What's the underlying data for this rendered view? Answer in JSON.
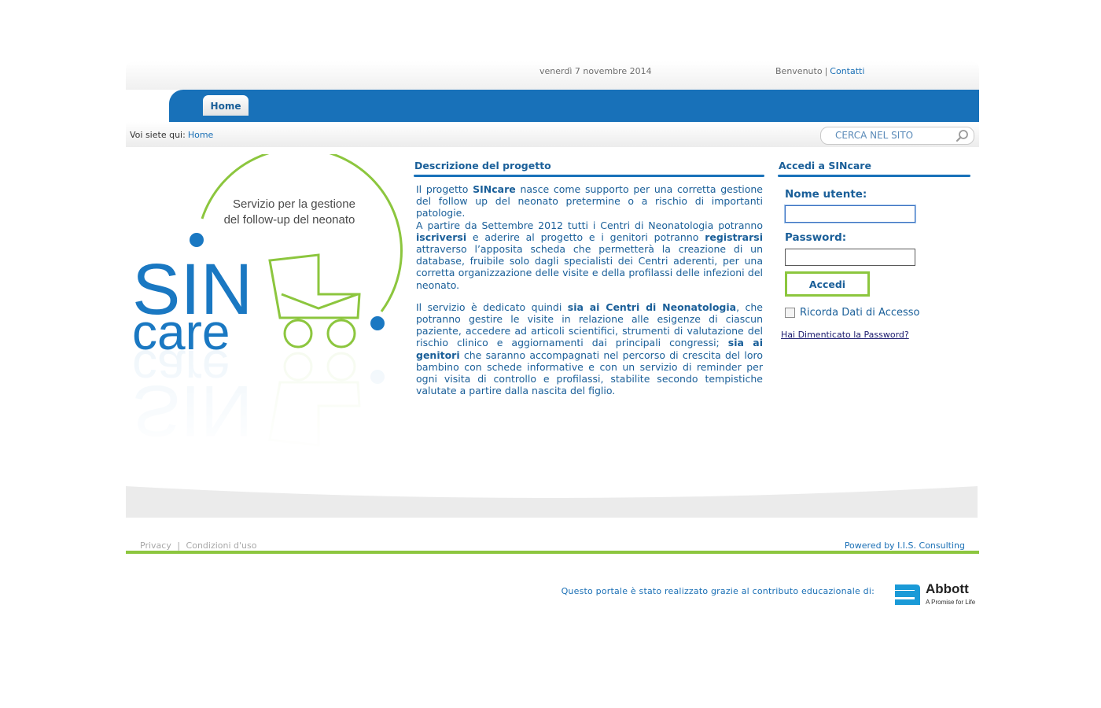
{
  "topbar": {
    "date": "venerdì 7 novembre 2014",
    "welcome": "Benvenuto",
    "separator": "|",
    "contact": "Contatti"
  },
  "nav": {
    "tabs": [
      {
        "label": "Home"
      }
    ]
  },
  "breadcrumb": {
    "prefix": "Voi siete qui:",
    "current": "Home"
  },
  "search": {
    "placeholder": "CERCA NEL SITO"
  },
  "logo": {
    "tagline_line1": "Servizio per la gestione",
    "tagline_line2": "del follow-up del neonato",
    "word1": "SIN",
    "word2": "care",
    "colors": {
      "blue": "#1a78c2",
      "green": "#8cc63e"
    }
  },
  "description": {
    "title": "Descrizione del progetto",
    "p1": [
      {
        "t": "Il progetto "
      },
      {
        "t": "SINcare",
        "b": true
      },
      {
        "t": " nasce come supporto per una corretta gestione del follow up del neonato pretermine o a rischio di importanti patologie."
      },
      {
        "br": true
      },
      {
        "t": "A partire da Settembre 2012 tutti i Centri di Neonatologia potranno "
      },
      {
        "t": "iscriversi",
        "b": true
      },
      {
        "t": " e aderire al progetto e i genitori potranno "
      },
      {
        "t": "registrarsi",
        "b": true
      },
      {
        "t": " attraverso l’apposita scheda che permetterà la creazione di un database, fruibile solo dagli specialisti dei Centri aderenti, per una corretta organizzazione delle visite e della profilassi delle infezioni del neonato."
      }
    ],
    "p2": [
      {
        "t": "Il servizio è dedicato quindi "
      },
      {
        "t": "sia ai Centri di Neonatologia",
        "b": true
      },
      {
        "t": ", che potranno gestire le visite in relazione alle esigenze di ciascun paziente, accedere ad articoli scientifici, strumenti di valutazione del rischio clinico e aggiornamenti dai principali congressi; "
      },
      {
        "t": "sia ai genitori",
        "b": true
      },
      {
        "t": " che saranno accompagnati nel percorso di crescita del loro bambino con schede informative e con un servizio di reminder per ogni visita di controllo e profilassi, stabilite secondo tempistiche valutate a partire dalla nascita del figlio."
      }
    ]
  },
  "login": {
    "title": "Accedi a SINcare",
    "username_label": "Nome utente:",
    "username_value": "",
    "password_label": "Password:",
    "password_value": "",
    "submit": "Accedi",
    "remember": "Ricorda Dati di Accesso",
    "remember_checked": false,
    "forgot": "Hai Dimenticato la Password?"
  },
  "footer": {
    "privacy": "Privacy",
    "separator": "|",
    "terms": "Condizioni d'uso",
    "powered": "Powered by I.I.S. Consulting",
    "sponsor_text": "Questo portale è stato realizzato grazie al contributo educazionale di:",
    "sponsor_logo": {
      "name": "Abbott",
      "tagline": "A Promise for Life",
      "icon": "abbott-logo-icon"
    }
  }
}
